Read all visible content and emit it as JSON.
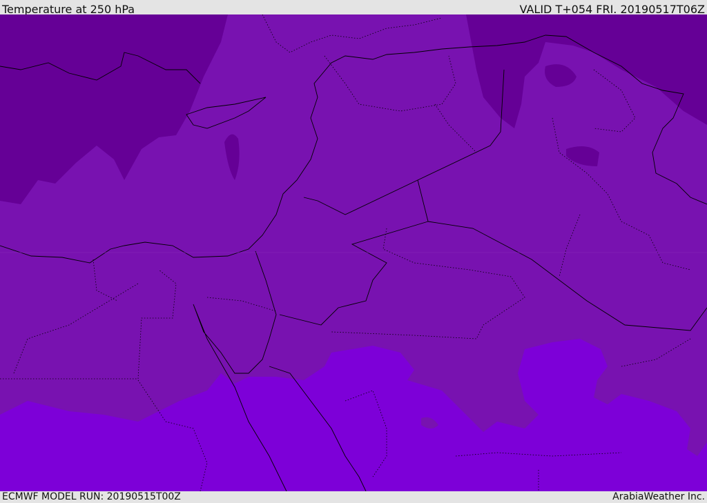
{
  "header": {
    "title": "Temperature at 250 hPa",
    "valid": "VALID T+054 FRI. 20190517T06Z"
  },
  "footer": {
    "model_run": "ECMWF MODEL RUN: 20190515T00Z",
    "credit": "ArabiaWeather Inc."
  },
  "colors": {
    "cold_band": "#650096",
    "mid_band": "#7812b0",
    "warm_band": "#7d00d8",
    "frame": "#e4e4e4"
  }
}
